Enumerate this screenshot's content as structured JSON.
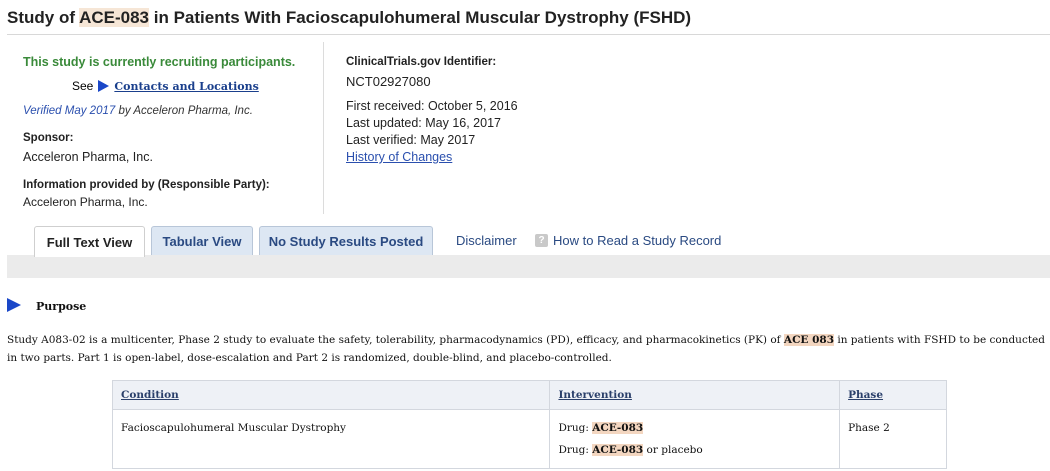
{
  "title": {
    "before": "Study of ",
    "highlight": "ACE-083",
    "after": " in Patients With Facioscapulohumeral Muscular Dystrophy (FSHD)"
  },
  "left": {
    "recruiting": "This study is currently recruiting participants.",
    "see_prefix": "See",
    "contacts_link": "Contacts and Locations",
    "verified_date": "Verified May 2017",
    "verified_by": " by Acceleron Pharma, Inc.",
    "sponsor_label": "Sponsor:",
    "sponsor_value": "Acceleron Pharma, Inc.",
    "info_label": "Information provided by (Responsible Party):",
    "info_value": "Acceleron Pharma, Inc."
  },
  "right": {
    "identifier_label": "ClinicalTrials.gov Identifier:",
    "identifier_value": "NCT02927080",
    "first_received": "First received: October 5, 2016",
    "last_updated": "Last updated: May 16, 2017",
    "last_verified": "Last verified: May 2017",
    "history_link": "History of Changes"
  },
  "tabs": {
    "full_text": "Full Text View",
    "tabular": "Tabular View",
    "no_results": "No Study Results Posted",
    "disclaimer": "Disclaimer",
    "how_to_read": "How to Read a Study Record",
    "help_icon_glyph": "?"
  },
  "purpose": {
    "heading": "Purpose",
    "text_before": "Study A083-02 is a multicenter, Phase 2 study to evaluate the safety, tolerability, pharmacodynamics (PD), efficacy, and pharmacokinetics (PK) of ",
    "text_mark": "ACE 083",
    "text_after": " in patients with FSHD to be conducted in two parts. Part 1 is open-label, dose-escalation and Part 2 is randomized, double-blind, and placebo-controlled."
  },
  "table": {
    "headers": [
      "Condition",
      "Intervention",
      "Phase"
    ],
    "condition": "Facioscapulohumeral Muscular Dystrophy",
    "drug_prefix": "Drug: ",
    "drug_name": "ACE-083",
    "drug2_suffix": " or placebo",
    "phase": "Phase 2"
  }
}
